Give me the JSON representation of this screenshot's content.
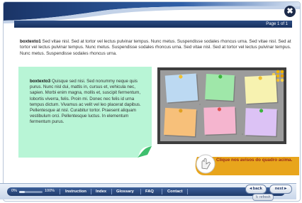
{
  "header": {
    "close_label": "✖",
    "page_indicator": "Page 1 of 1"
  },
  "intro": {
    "bold": "boxtexto1",
    "text": " Sed vitae nisl. Sed at tortor vel lectus pulvinar tempus. Nunc metus. Suspendisse sodales rhoncus urna. Sed vitae nisl. Sed at tortor vel lectus pulvinar tempus. Nunc metus. Suspendisse sodales rhoncus urna. Sed vitae nisl. Sed at tortor vel lectus pulvinar tempus. Nunc metus. Suspendisse sodales rhoncus urna."
  },
  "note": {
    "bold": "boxtexto3",
    "text": " Quisque sed nisi. Sed nonummy neque quis purus. Nunc nisl dui, mattis in, cursus et, vehicula nec, sapien. Morbi enim magna, mollis et, suscipit fermentum, lobortis viverra, felis. Proin mi. Donec nec felis id urna tempus dictum. Vivamus ac velit vel leo placerat dapibus. Pellentesque at nisl. Curabitur tortor. Praesent aliquam vestibulum orci. Pellentesque luctus. In elementum fermentum purus."
  },
  "board": {
    "colors": {
      "frame": "#4a4a4a",
      "cork": "#9a9a9a",
      "accent": "#f0b400"
    },
    "notes": [
      {
        "name": "note-blue",
        "color": "#bcd9f2",
        "pin": "#f0c030"
      },
      {
        "name": "note-green",
        "color": "#9fe7a9",
        "pin": "#3cb43c"
      },
      {
        "name": "note-yellow",
        "color": "#f7f2b0",
        "pin": "#f0c030"
      },
      {
        "name": "note-orange",
        "color": "#f7c07a",
        "pin": "#e0a020"
      },
      {
        "name": "note-pink",
        "color": "#f5b5cf",
        "pin": "#e05050"
      },
      {
        "name": "note-purple",
        "color": "#dcc2f5",
        "pin": "#3cb43c"
      }
    ]
  },
  "tip": {
    "text": "Clique nos avisos do quadro acima."
  },
  "footer": {
    "progress_start": "0%",
    "progress_end": "100%",
    "progress_value": 0.25,
    "links": [
      "Instruction",
      "Index",
      "Glossary",
      "FAQ",
      "Contact"
    ],
    "back_label": "back",
    "next_label": "next",
    "refresh_label": "refresh"
  },
  "colors": {
    "navy": "#1f3a6b",
    "mint": "#b8f5d6",
    "tip_orange": "#e8a51c"
  }
}
